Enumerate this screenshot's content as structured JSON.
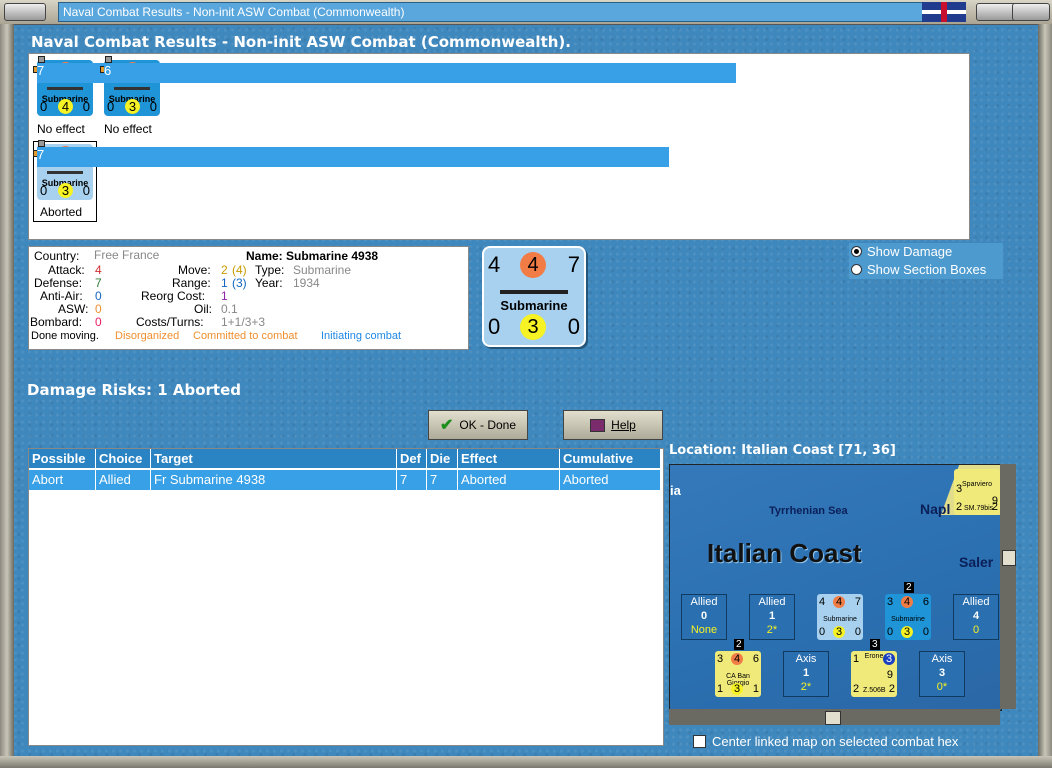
{
  "window": {
    "title": "Naval Combat Results - Non-init ASW Combat (Commonwealth)"
  },
  "heading": "Naval Combat Results - Non-init ASW Combat (Commonwealth).",
  "results": [
    {
      "tl": "3",
      "tc": "4",
      "tr": "7",
      "name": "Submarine",
      "bl": "0",
      "bc": "4",
      "br": "0",
      "caption": "No effect"
    },
    {
      "tl": "3",
      "tc": "4",
      "tr": "6",
      "name": "Submarine",
      "bl": "0",
      "bc": "3",
      "br": "0",
      "caption": "No effect"
    },
    {
      "tl": "4",
      "tc": "4",
      "tr": "7",
      "name": "Submarine",
      "bl": "0",
      "bc": "3",
      "br": "0",
      "caption": "Aborted"
    }
  ],
  "info": {
    "country_label": "Country:",
    "country": "Free France",
    "name_label": "Name: Submarine 4938",
    "attack_label": "Attack:",
    "attack": "4",
    "defense_label": "Defense:",
    "defense": "7",
    "antiair_label": "Anti-Air:",
    "antiair": "0",
    "asw_label": "ASW:",
    "asw": "0",
    "bombard_label": "Bombard:",
    "bombard": "0",
    "move_label": "Move:",
    "move": "2",
    "move_extra": "(4)",
    "type_label": "Type:",
    "type": "Submarine",
    "range_label": "Range:",
    "range": "1",
    "range_extra": "(3)",
    "year_label": "Year:",
    "year": "1934",
    "reorg_label": "Reorg Cost:",
    "reorg": "1",
    "oil_label": "Oil:",
    "oil": "0.1",
    "costs_label": "Costs/Turns:",
    "costs": "1+1/3+3",
    "status1": "Done moving.",
    "status2": "Disorganized",
    "status3": "Committed to combat",
    "status4": "Initiating combat"
  },
  "big_counter": {
    "tl": "4",
    "tc": "4",
    "tr": "7",
    "name": "Submarine",
    "bl": "0",
    "bc": "3",
    "br": "0"
  },
  "options": {
    "show_damage": "Show Damage",
    "show_section": "Show Section Boxes"
  },
  "damage_risks": "Damage Risks:  1 Aborted",
  "buttons": {
    "ok": "OK - Done",
    "help": "Help"
  },
  "table": {
    "headers": [
      "Possible",
      "Choice",
      "Target",
      "Def",
      "Die",
      "Effect",
      "Cumulative"
    ],
    "rows": [
      [
        "Abort",
        "Allied",
        "Fr Submarine 4938",
        "7",
        "7",
        "Aborted",
        "Aborted"
      ]
    ]
  },
  "location": "Location:  Italian Coast [71, 36]",
  "map": {
    "sea_label": "Tyrrhenian Sea",
    "region": "Italian Coast",
    "city1": "Napl",
    "city2": "Saler",
    "edge": "ia",
    "boxes": [
      {
        "side": "Allied",
        "num": "0",
        "sub": "None"
      },
      {
        "side": "Allied",
        "num": "1",
        "sub": "2*"
      },
      {
        "side": "Allied",
        "num": "4",
        "sub": "0"
      },
      {
        "side": "Axis",
        "num": "1",
        "sub": "2*"
      },
      {
        "side": "Axis",
        "num": "3",
        "sub": "0*"
      }
    ],
    "units": [
      {
        "a": "4",
        "b": "4",
        "c": "7",
        "name": "Submarine",
        "d": "0",
        "e": "3",
        "f": "0"
      },
      {
        "a": "3",
        "b": "4",
        "c": "6",
        "name": "Submarine",
        "d": "0",
        "e": "3",
        "f": "0",
        "stack": "2"
      },
      {
        "a": "3",
        "b": "4",
        "c": "6",
        "name": "CA Ban Giorgio",
        "d": "1",
        "e": "3",
        "f": "1",
        "stack": "2"
      },
      {
        "a": "1",
        "b": "3",
        "name": "Erone",
        "c": "9",
        "d": "2",
        "e": "Z.506B",
        "f": "2",
        "stack": "3"
      },
      {
        "a": "3",
        "name": "Sparviero",
        "c": "9",
        "d": "2",
        "e": "SM.79bis",
        "f": "2",
        "stack": "2"
      }
    ]
  },
  "center_map": "Center linked map on selected combat hex",
  "colors": {
    "accent": "#37a0e6",
    "attack": "#f27c46",
    "defense_circle": "#f6f223"
  }
}
